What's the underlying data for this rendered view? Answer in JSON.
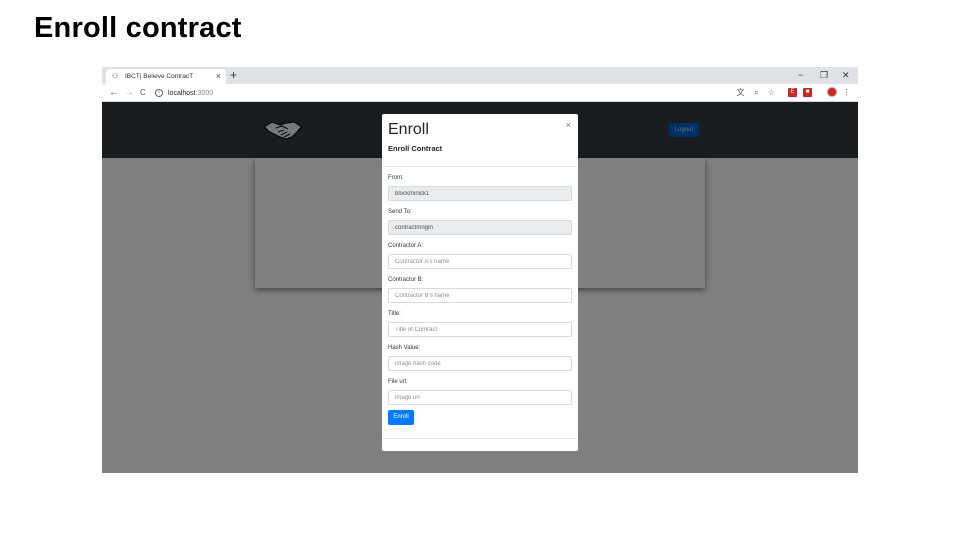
{
  "slide": {
    "title": "Enroll contract"
  },
  "browser": {
    "tab_title": "IBCT| Believe ContracT",
    "tab_close": "×",
    "new_tab": "+",
    "url_host": "localhost",
    "url_port": ":3000",
    "window_controls": {
      "minimize": "−",
      "maximize": "❐",
      "close": "✕"
    },
    "nav": {
      "back": "←",
      "forward": "→",
      "reload": "C"
    }
  },
  "app": {
    "navbar": {
      "logout_label": "Logout"
    }
  },
  "modal": {
    "title": "Enroll",
    "subtitle": "Enroll Contract",
    "close": "×",
    "fields": {
      "from": {
        "label": "From:",
        "value": "blockminick1"
      },
      "send_to": {
        "label": "Send To:",
        "value": "contractmngm"
      },
      "contractor_a": {
        "label": "Contractor A:",
        "placeholder": "Contractor A's name"
      },
      "contractor_b": {
        "label": "Contractor B:",
        "placeholder": "Contractor B's name"
      },
      "title": {
        "label": "Title:",
        "placeholder": "Title of Contract"
      },
      "hash_value": {
        "label": "Hash Value:",
        "placeholder": "image hash code"
      },
      "file_url": {
        "label": "File url:",
        "placeholder": "image url"
      }
    },
    "submit_label": "Enroll"
  },
  "colors": {
    "navbar": "#343a40",
    "primary": "#007bff",
    "logout": "#0062cc",
    "backdrop": "rgba(0,0,0,0.5)",
    "readonly_field": "#e9ecef"
  },
  "icons": [
    "handshake-icon",
    "info-icon",
    "translate-icon",
    "zoom-icon",
    "star-icon",
    "extension-icon",
    "profile-avatar"
  ]
}
